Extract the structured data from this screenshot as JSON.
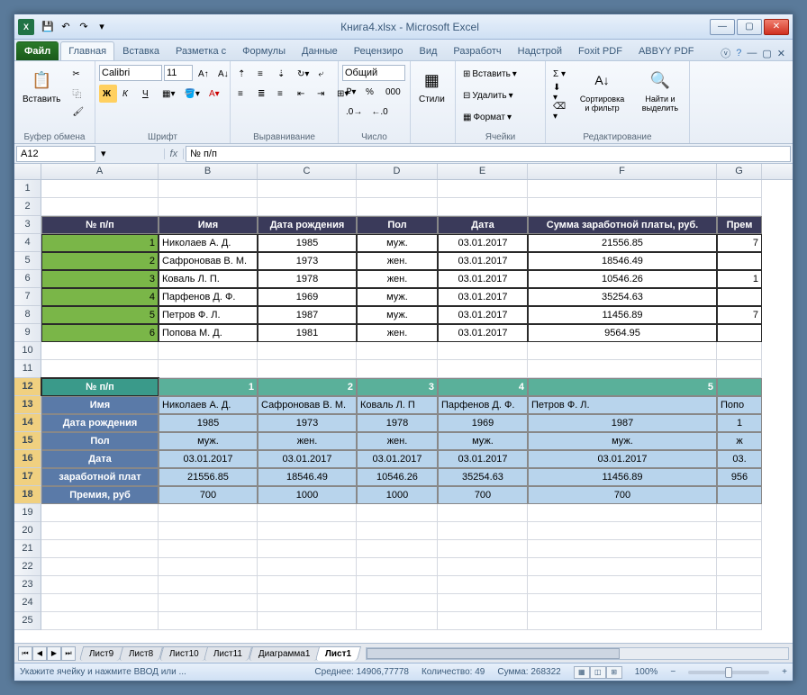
{
  "window": {
    "title": "Книга4.xlsx  -  Microsoft Excel"
  },
  "tabs": {
    "file": "Файл",
    "list": [
      "Главная",
      "Вставка",
      "Разметка с",
      "Формулы",
      "Данные",
      "Рецензиро",
      "Вид",
      "Разработч",
      "Надстрой",
      "Foxit PDF",
      "ABBYY PDF"
    ],
    "active": "Главная"
  },
  "ribbon": {
    "paste": "Вставить",
    "clipboard": "Буфер обмена",
    "font_name": "Calibri",
    "font_size": "11",
    "font_group": "Шрифт",
    "align_group": "Выравнивание",
    "number_format": "Общий",
    "number_group": "Число",
    "styles": "Стили",
    "insert": "Вставить",
    "delete": "Удалить",
    "format": "Формат",
    "cells_group": "Ячейки",
    "sort": "Сортировка и фильтр",
    "find": "Найти и выделить",
    "editing_group": "Редактирование"
  },
  "name_box": "A12",
  "formula": "№ п/п",
  "columns": {
    "A": 130,
    "B": 110,
    "C": 110,
    "D": 90,
    "E": 100,
    "F": 210,
    "G": 50
  },
  "table1": {
    "headers": [
      "№ п/п",
      "Имя",
      "Дата рождения",
      "Пол",
      "Дата",
      "Сумма заработной платы, руб.",
      "Прем"
    ],
    "rows": [
      {
        "n": "1",
        "name": "Николаев А. Д.",
        "dob": "1985",
        "sex": "муж.",
        "date": "03.01.2017",
        "sum": "21556.85",
        "g": "7"
      },
      {
        "n": "2",
        "name": "Сафроновав В. М.",
        "dob": "1973",
        "sex": "жен.",
        "date": "03.01.2017",
        "sum": "18546.49",
        "g": ""
      },
      {
        "n": "3",
        "name": "Коваль Л. П.",
        "dob": "1978",
        "sex": "жен.",
        "date": "03.01.2017",
        "sum": "10546.26",
        "g": "1"
      },
      {
        "n": "4",
        "name": "Парфенов Д. Ф.",
        "dob": "1969",
        "sex": "муж.",
        "date": "03.01.2017",
        "sum": "35254.63",
        "g": ""
      },
      {
        "n": "5",
        "name": "Петров Ф. Л.",
        "dob": "1987",
        "sex": "муж.",
        "date": "03.01.2017",
        "sum": "11456.89",
        "g": "7"
      },
      {
        "n": "6",
        "name": "Попова М. Д.",
        "dob": "1981",
        "sex": "жен.",
        "date": "03.01.2017",
        "sum": "9564.95",
        "g": ""
      }
    ]
  },
  "table2": {
    "row_labels": [
      "№ п/п",
      "Имя",
      "Дата рождения",
      "Пол",
      "Дата",
      "заработной плат",
      "Премия, руб"
    ],
    "nums": [
      "1",
      "2",
      "3",
      "4",
      "5"
    ],
    "names": [
      "Николаев А. Д.",
      "Сафроновав В. М.",
      "Коваль Л. П",
      "Парфенов Д. Ф.",
      "Петров Ф. Л.",
      "Попо"
    ],
    "dob": [
      "1985",
      "1973",
      "1978",
      "1969",
      "1987",
      "1"
    ],
    "sex": [
      "муж.",
      "жен.",
      "жен.",
      "муж.",
      "муж.",
      "ж"
    ],
    "date": [
      "03.01.2017",
      "03.01.2017",
      "03.01.2017",
      "03.01.2017",
      "03.01.2017",
      "03."
    ],
    "sum": [
      "21556.85",
      "18546.49",
      "10546.26",
      "35254.63",
      "11456.89",
      "956"
    ],
    "bonus": [
      "700",
      "1000",
      "1000",
      "700",
      "700",
      ""
    ]
  },
  "sheets": [
    "Лист9",
    "Лист8",
    "Лист10",
    "Лист11",
    "Диаграмма1",
    "Лист1"
  ],
  "active_sheet": "Лист1",
  "status": {
    "prompt": "Укажите ячейку и нажмите ВВОД или ...",
    "avg_label": "Среднее:",
    "avg": "14906,77778",
    "count_label": "Количество:",
    "count": "49",
    "sum_label": "Сумма:",
    "sum": "268322",
    "zoom": "100%"
  }
}
